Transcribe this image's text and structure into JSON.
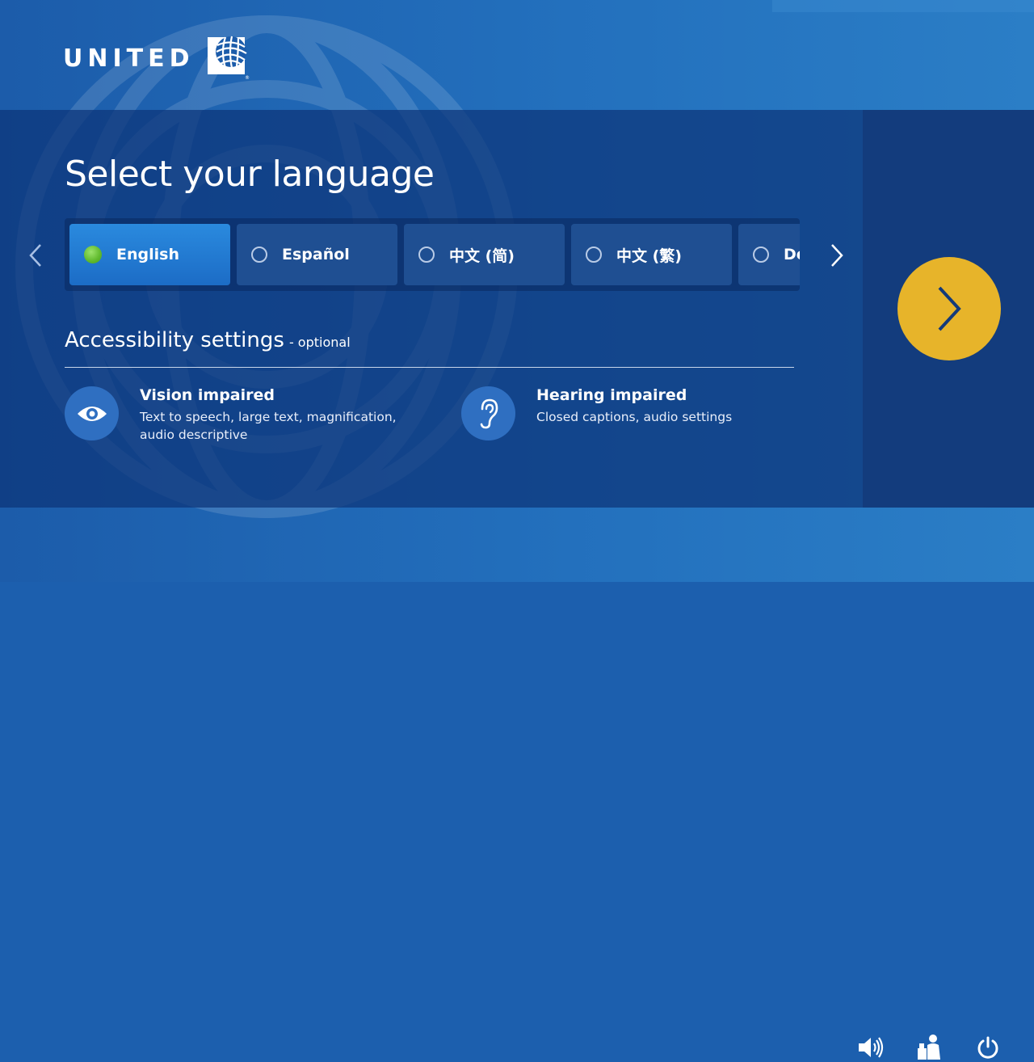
{
  "brand": {
    "name": "UNITED",
    "logo_icon": "united-globe-icon"
  },
  "main": {
    "title": "Select your language"
  },
  "languages": {
    "prev_icon": "chevron-left-icon",
    "next_icon": "chevron-right-icon",
    "items": [
      {
        "label": "English",
        "selected": true
      },
      {
        "label": "Español",
        "selected": false
      },
      {
        "label": "中文 (简)",
        "selected": false
      },
      {
        "label": "中文 (繁)",
        "selected": false
      },
      {
        "label": "De",
        "selected": false
      }
    ]
  },
  "accessibility": {
    "heading": "Accessibility settings",
    "optional": "- optional",
    "vision": {
      "title": "Vision impaired",
      "description": "Text to speech, large text, magnification, audio descriptive",
      "icon": "eye-icon"
    },
    "hearing": {
      "title": "Hearing impaired",
      "description": "Closed captions, audio settings",
      "icon": "ear-icon"
    }
  },
  "next_button": {
    "icon": "chevron-right-icon",
    "color": "#e7b42a"
  },
  "footer": {
    "icons": [
      "volume-icon",
      "call-attendant-icon",
      "power-icon"
    ]
  },
  "colors": {
    "accent": "#e7b42a",
    "selected_radio": "#5fb92c",
    "panel": "#0d3478"
  }
}
